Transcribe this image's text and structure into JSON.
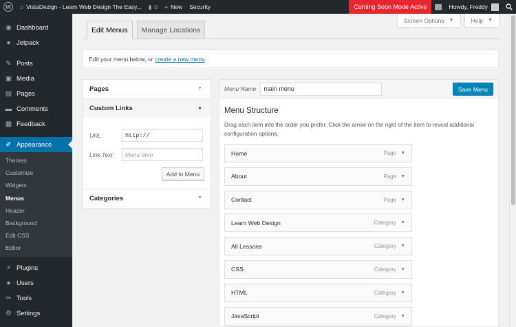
{
  "adminbar": {
    "site_title": "VistaDezign - Learn Web Design The Easy...",
    "comments_count": "0",
    "new_label": "New",
    "security_label": "Security",
    "coming_soon": "Coming Soon Mode Active",
    "greeting": "Howdy, Freddy"
  },
  "sidebar": {
    "top_items": [
      {
        "label": "Dashboard",
        "icon": "dashboard-icon"
      },
      {
        "label": "Jetpack",
        "icon": "jetpack-icon"
      }
    ],
    "items": [
      {
        "label": "Posts",
        "icon": "pin-icon"
      },
      {
        "label": "Media",
        "icon": "media-icon"
      },
      {
        "label": "Pages",
        "icon": "pages-icon"
      },
      {
        "label": "Comments",
        "icon": "comments-icon"
      },
      {
        "label": "Feedback",
        "icon": "feedback-icon"
      }
    ],
    "appearance_label": "Appearance",
    "submenu": [
      "Themes",
      "Customize",
      "Widgets",
      "Menus",
      "Header",
      "Background",
      "Edit CSS",
      "Editor"
    ],
    "current_sub": "Menus",
    "bottom_items": [
      {
        "label": "Plugins",
        "icon": "plugins-icon"
      },
      {
        "label": "Users",
        "icon": "users-icon"
      },
      {
        "label": "Tools",
        "icon": "tools-icon"
      },
      {
        "label": "Settings",
        "icon": "settings-icon"
      }
    ]
  },
  "screen_meta": {
    "screen_options": "Screen Options",
    "help": "Help"
  },
  "tabs": {
    "edit_menus": "Edit Menus",
    "manage_locations": "Manage Locations"
  },
  "manage": {
    "text": "Edit your menu below, or",
    "link": "create a new menu",
    "end": "."
  },
  "accordion": {
    "pages": "Pages",
    "custom_links": "Custom Links",
    "url_label": "URL",
    "url_value": "http://",
    "link_text_label": "Link Text",
    "link_text_placeholder": "Menu Item",
    "add_to_menu": "Add to Menu",
    "categories": "Categories"
  },
  "menu": {
    "name_label": "Menu Name",
    "name_value": "main menu",
    "save_label": "Save Menu",
    "structure_title": "Menu Structure",
    "instructions": "Drag each item into the order you prefer. Click the arrow on the right of the item to reveal additional configuration options.",
    "items": [
      {
        "title": "Home",
        "type": "Page"
      },
      {
        "title": "About",
        "type": "Page"
      },
      {
        "title": "Contact",
        "type": "Page"
      },
      {
        "title": "Learn Web Design",
        "type": "Category"
      },
      {
        "title": "All Lessons",
        "type": "Category"
      },
      {
        "title": "CSS",
        "type": "Category"
      },
      {
        "title": "HTML",
        "type": "Category"
      },
      {
        "title": "JavaScript",
        "type": "Category"
      }
    ]
  },
  "colors": {
    "adminbar_bg": "#23282d",
    "accent": "#0073aa",
    "coming_soon_bg": "#e8262f",
    "primary_button": "#0085ba"
  }
}
